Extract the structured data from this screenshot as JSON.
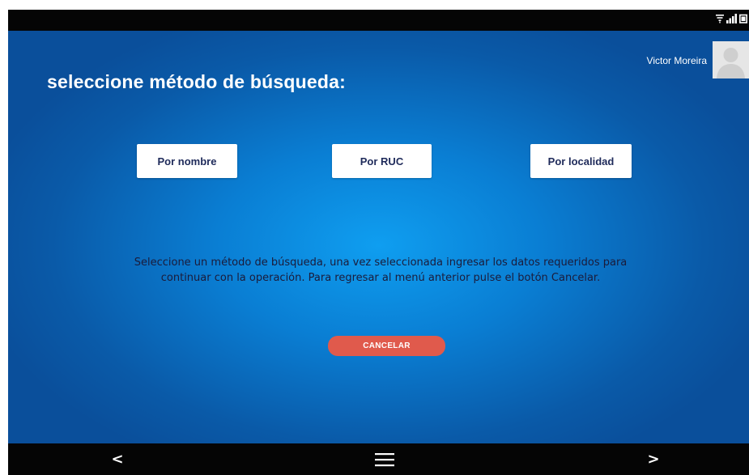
{
  "header": {
    "title": "seleccione método de búsqueda:",
    "user_name": "Victor Moreira"
  },
  "search_methods": {
    "by_name": "Por nombre",
    "by_ruc": "Por RUC",
    "by_locality": "Por localidad"
  },
  "instructions": "Seleccione un método de búsqueda, una vez seleccionada ingresar los datos requeridos para continuar con la operación. Para regresar al menú anterior pulse el botón Cancelar.",
  "cancel_label": "CANCELAR",
  "nav": {
    "back_label": "<",
    "forward_label": ">"
  },
  "status_icons": [
    "wifi-icon",
    "signal-icon",
    "battery-icon"
  ],
  "colors": {
    "background": "#0a6fc4",
    "cancel_button": "#e05a4c",
    "button_text": "#1e2a5a"
  }
}
